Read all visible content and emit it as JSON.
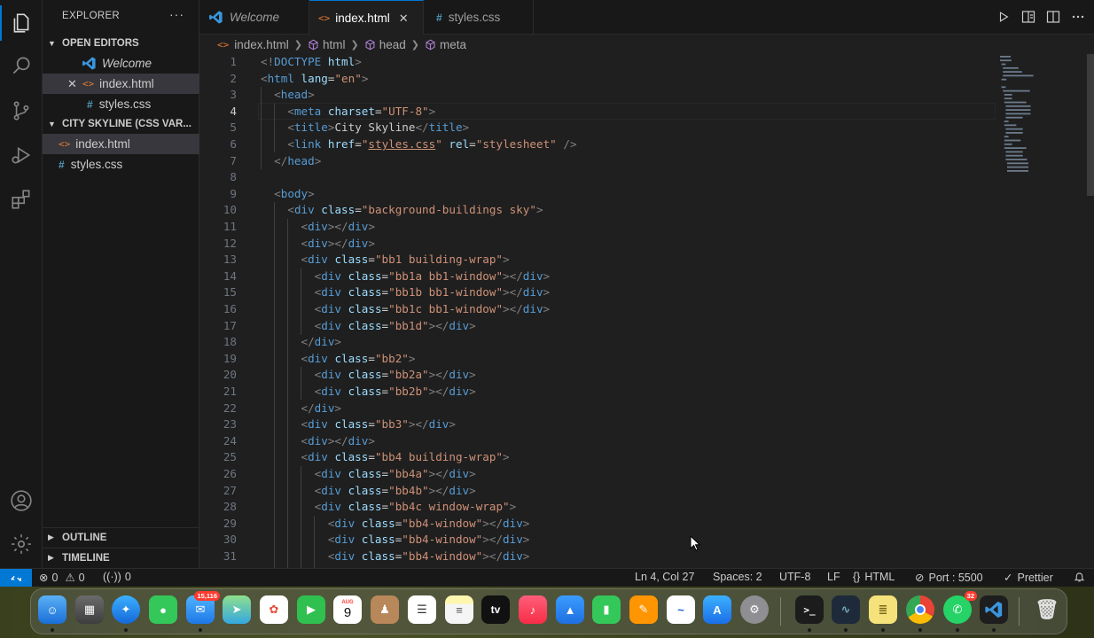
{
  "sidebar": {
    "title": "EXPLORER",
    "more": "···",
    "open_editors": {
      "label": "OPEN EDITORS",
      "items": [
        {
          "label": "Welcome"
        },
        {
          "label": "index.html"
        },
        {
          "label": "styles.css"
        }
      ]
    },
    "project": {
      "label": "CITY SKYLINE (CSS VAR...",
      "items": [
        {
          "label": "index.html"
        },
        {
          "label": "styles.css"
        }
      ]
    },
    "outline": "OUTLINE",
    "timeline": "TIMELINE"
  },
  "tabs": [
    {
      "label": "Welcome"
    },
    {
      "label": "index.html"
    },
    {
      "label": "styles.css"
    }
  ],
  "breadcrumb": [
    "index.html",
    "html",
    "head",
    "meta"
  ],
  "editor": {
    "current_line": 4,
    "lines": [
      [
        [
          "p",
          "<!"
        ],
        [
          "tag",
          "DOCTYPE"
        ],
        [
          "c",
          " "
        ],
        [
          "attr",
          "html"
        ],
        [
          "p",
          ">"
        ]
      ],
      [
        [
          "p",
          "<"
        ],
        [
          "tag",
          "html"
        ],
        [
          "c",
          " "
        ],
        [
          "attr",
          "lang"
        ],
        [
          "c",
          "="
        ],
        [
          "str",
          "\"en\""
        ],
        [
          "p",
          ">"
        ]
      ],
      [
        [
          "c",
          "  "
        ],
        [
          "p",
          "<"
        ],
        [
          "tag",
          "head"
        ],
        [
          "p",
          ">"
        ]
      ],
      [
        [
          "c",
          "    "
        ],
        [
          "p",
          "<"
        ],
        [
          "tag",
          "meta"
        ],
        [
          "c",
          " "
        ],
        [
          "attr",
          "charset"
        ],
        [
          "c",
          "="
        ],
        [
          "str",
          "\"UTF-8\""
        ],
        [
          "p",
          ">"
        ]
      ],
      [
        [
          "c",
          "    "
        ],
        [
          "p",
          "<"
        ],
        [
          "tag",
          "title"
        ],
        [
          "p",
          ">"
        ],
        [
          "c",
          "City Skyline"
        ],
        [
          "p",
          "</"
        ],
        [
          "tag",
          "title"
        ],
        [
          "p",
          ">"
        ]
      ],
      [
        [
          "c",
          "    "
        ],
        [
          "p",
          "<"
        ],
        [
          "tag",
          "link"
        ],
        [
          "c",
          " "
        ],
        [
          "attr",
          "href"
        ],
        [
          "c",
          "="
        ],
        [
          "str",
          "\""
        ],
        [
          "stru",
          "styles.css"
        ],
        [
          "str",
          "\""
        ],
        [
          "c",
          " "
        ],
        [
          "attr",
          "rel"
        ],
        [
          "c",
          "="
        ],
        [
          "str",
          "\"stylesheet\""
        ],
        [
          "c",
          " "
        ],
        [
          "p",
          "/>"
        ]
      ],
      [
        [
          "c",
          "  "
        ],
        [
          "p",
          "</"
        ],
        [
          "tag",
          "head"
        ],
        [
          "p",
          ">"
        ]
      ],
      [],
      [
        [
          "c",
          "  "
        ],
        [
          "p",
          "<"
        ],
        [
          "tag",
          "body"
        ],
        [
          "p",
          ">"
        ]
      ],
      [
        [
          "c",
          "    "
        ],
        [
          "p",
          "<"
        ],
        [
          "tag",
          "div"
        ],
        [
          "c",
          " "
        ],
        [
          "attr",
          "class"
        ],
        [
          "c",
          "="
        ],
        [
          "str",
          "\"background-buildings sky\""
        ],
        [
          "p",
          ">"
        ]
      ],
      [
        [
          "c",
          "      "
        ],
        [
          "p",
          "<"
        ],
        [
          "tag",
          "div"
        ],
        [
          "p",
          "></"
        ],
        [
          "tag",
          "div"
        ],
        [
          "p",
          ">"
        ]
      ],
      [
        [
          "c",
          "      "
        ],
        [
          "p",
          "<"
        ],
        [
          "tag",
          "div"
        ],
        [
          "p",
          "></"
        ],
        [
          "tag",
          "div"
        ],
        [
          "p",
          ">"
        ]
      ],
      [
        [
          "c",
          "      "
        ],
        [
          "p",
          "<"
        ],
        [
          "tag",
          "div"
        ],
        [
          "c",
          " "
        ],
        [
          "attr",
          "class"
        ],
        [
          "c",
          "="
        ],
        [
          "str",
          "\"bb1 building-wrap\""
        ],
        [
          "p",
          ">"
        ]
      ],
      [
        [
          "c",
          "        "
        ],
        [
          "p",
          "<"
        ],
        [
          "tag",
          "div"
        ],
        [
          "c",
          " "
        ],
        [
          "attr",
          "class"
        ],
        [
          "c",
          "="
        ],
        [
          "str",
          "\"bb1a bb1-window\""
        ],
        [
          "p",
          "></"
        ],
        [
          "tag",
          "div"
        ],
        [
          "p",
          ">"
        ]
      ],
      [
        [
          "c",
          "        "
        ],
        [
          "p",
          "<"
        ],
        [
          "tag",
          "div"
        ],
        [
          "c",
          " "
        ],
        [
          "attr",
          "class"
        ],
        [
          "c",
          "="
        ],
        [
          "str",
          "\"bb1b bb1-window\""
        ],
        [
          "p",
          "></"
        ],
        [
          "tag",
          "div"
        ],
        [
          "p",
          ">"
        ]
      ],
      [
        [
          "c",
          "        "
        ],
        [
          "p",
          "<"
        ],
        [
          "tag",
          "div"
        ],
        [
          "c",
          " "
        ],
        [
          "attr",
          "class"
        ],
        [
          "c",
          "="
        ],
        [
          "str",
          "\"bb1c bb1-window\""
        ],
        [
          "p",
          "></"
        ],
        [
          "tag",
          "div"
        ],
        [
          "p",
          ">"
        ]
      ],
      [
        [
          "c",
          "        "
        ],
        [
          "p",
          "<"
        ],
        [
          "tag",
          "div"
        ],
        [
          "c",
          " "
        ],
        [
          "attr",
          "class"
        ],
        [
          "c",
          "="
        ],
        [
          "str",
          "\"bb1d\""
        ],
        [
          "p",
          "></"
        ],
        [
          "tag",
          "div"
        ],
        [
          "p",
          ">"
        ]
      ],
      [
        [
          "c",
          "      "
        ],
        [
          "p",
          "</"
        ],
        [
          "tag",
          "div"
        ],
        [
          "p",
          ">"
        ]
      ],
      [
        [
          "c",
          "      "
        ],
        [
          "p",
          "<"
        ],
        [
          "tag",
          "div"
        ],
        [
          "c",
          " "
        ],
        [
          "attr",
          "class"
        ],
        [
          "c",
          "="
        ],
        [
          "str",
          "\"bb2\""
        ],
        [
          "p",
          ">"
        ]
      ],
      [
        [
          "c",
          "        "
        ],
        [
          "p",
          "<"
        ],
        [
          "tag",
          "div"
        ],
        [
          "c",
          " "
        ],
        [
          "attr",
          "class"
        ],
        [
          "c",
          "="
        ],
        [
          "str",
          "\"bb2a\""
        ],
        [
          "p",
          "></"
        ],
        [
          "tag",
          "div"
        ],
        [
          "p",
          ">"
        ]
      ],
      [
        [
          "c",
          "        "
        ],
        [
          "p",
          "<"
        ],
        [
          "tag",
          "div"
        ],
        [
          "c",
          " "
        ],
        [
          "attr",
          "class"
        ],
        [
          "c",
          "="
        ],
        [
          "str",
          "\"bb2b\""
        ],
        [
          "p",
          "></"
        ],
        [
          "tag",
          "div"
        ],
        [
          "p",
          ">"
        ]
      ],
      [
        [
          "c",
          "      "
        ],
        [
          "p",
          "</"
        ],
        [
          "tag",
          "div"
        ],
        [
          "p",
          ">"
        ]
      ],
      [
        [
          "c",
          "      "
        ],
        [
          "p",
          "<"
        ],
        [
          "tag",
          "div"
        ],
        [
          "c",
          " "
        ],
        [
          "attr",
          "class"
        ],
        [
          "c",
          "="
        ],
        [
          "str",
          "\"bb3\""
        ],
        [
          "p",
          "></"
        ],
        [
          "tag",
          "div"
        ],
        [
          "p",
          ">"
        ]
      ],
      [
        [
          "c",
          "      "
        ],
        [
          "p",
          "<"
        ],
        [
          "tag",
          "div"
        ],
        [
          "p",
          "></"
        ],
        [
          "tag",
          "div"
        ],
        [
          "p",
          ">"
        ]
      ],
      [
        [
          "c",
          "      "
        ],
        [
          "p",
          "<"
        ],
        [
          "tag",
          "div"
        ],
        [
          "c",
          " "
        ],
        [
          "attr",
          "class"
        ],
        [
          "c",
          "="
        ],
        [
          "str",
          "\"bb4 building-wrap\""
        ],
        [
          "p",
          ">"
        ]
      ],
      [
        [
          "c",
          "        "
        ],
        [
          "p",
          "<"
        ],
        [
          "tag",
          "div"
        ],
        [
          "c",
          " "
        ],
        [
          "attr",
          "class"
        ],
        [
          "c",
          "="
        ],
        [
          "str",
          "\"bb4a\""
        ],
        [
          "p",
          "></"
        ],
        [
          "tag",
          "div"
        ],
        [
          "p",
          ">"
        ]
      ],
      [
        [
          "c",
          "        "
        ],
        [
          "p",
          "<"
        ],
        [
          "tag",
          "div"
        ],
        [
          "c",
          " "
        ],
        [
          "attr",
          "class"
        ],
        [
          "c",
          "="
        ],
        [
          "str",
          "\"bb4b\""
        ],
        [
          "p",
          "></"
        ],
        [
          "tag",
          "div"
        ],
        [
          "p",
          ">"
        ]
      ],
      [
        [
          "c",
          "        "
        ],
        [
          "p",
          "<"
        ],
        [
          "tag",
          "div"
        ],
        [
          "c",
          " "
        ],
        [
          "attr",
          "class"
        ],
        [
          "c",
          "="
        ],
        [
          "str",
          "\"bb4c window-wrap\""
        ],
        [
          "p",
          ">"
        ]
      ],
      [
        [
          "c",
          "          "
        ],
        [
          "p",
          "<"
        ],
        [
          "tag",
          "div"
        ],
        [
          "c",
          " "
        ],
        [
          "attr",
          "class"
        ],
        [
          "c",
          "="
        ],
        [
          "str",
          "\"bb4-window\""
        ],
        [
          "p",
          "></"
        ],
        [
          "tag",
          "div"
        ],
        [
          "p",
          ">"
        ]
      ],
      [
        [
          "c",
          "          "
        ],
        [
          "p",
          "<"
        ],
        [
          "tag",
          "div"
        ],
        [
          "c",
          " "
        ],
        [
          "attr",
          "class"
        ],
        [
          "c",
          "="
        ],
        [
          "str",
          "\"bb4-window\""
        ],
        [
          "p",
          "></"
        ],
        [
          "tag",
          "div"
        ],
        [
          "p",
          ">"
        ]
      ],
      [
        [
          "c",
          "          "
        ],
        [
          "p",
          "<"
        ],
        [
          "tag",
          "div"
        ],
        [
          "c",
          " "
        ],
        [
          "attr",
          "class"
        ],
        [
          "c",
          "="
        ],
        [
          "str",
          "\"bb4-window\""
        ],
        [
          "p",
          "></"
        ],
        [
          "tag",
          "div"
        ],
        [
          "p",
          ">"
        ]
      ]
    ]
  },
  "status": {
    "errors": "0",
    "warnings": "0",
    "ports": "0",
    "position": "Ln 4, Col 27",
    "spaces": "Spaces: 2",
    "encoding": "UTF-8",
    "eol": "LF",
    "language": "HTML",
    "port": "Port : 5500",
    "formatter": "Prettier"
  },
  "dock": {
    "mail_badge": "15,116",
    "calendar_month": "AUG",
    "calendar_day": "9",
    "appletv_label": "tv",
    "whatsapp_badge": "32"
  },
  "colors": {
    "accent": "#0078d4",
    "editor_bg": "#1f1f1f",
    "sidebar_bg": "#181818"
  }
}
